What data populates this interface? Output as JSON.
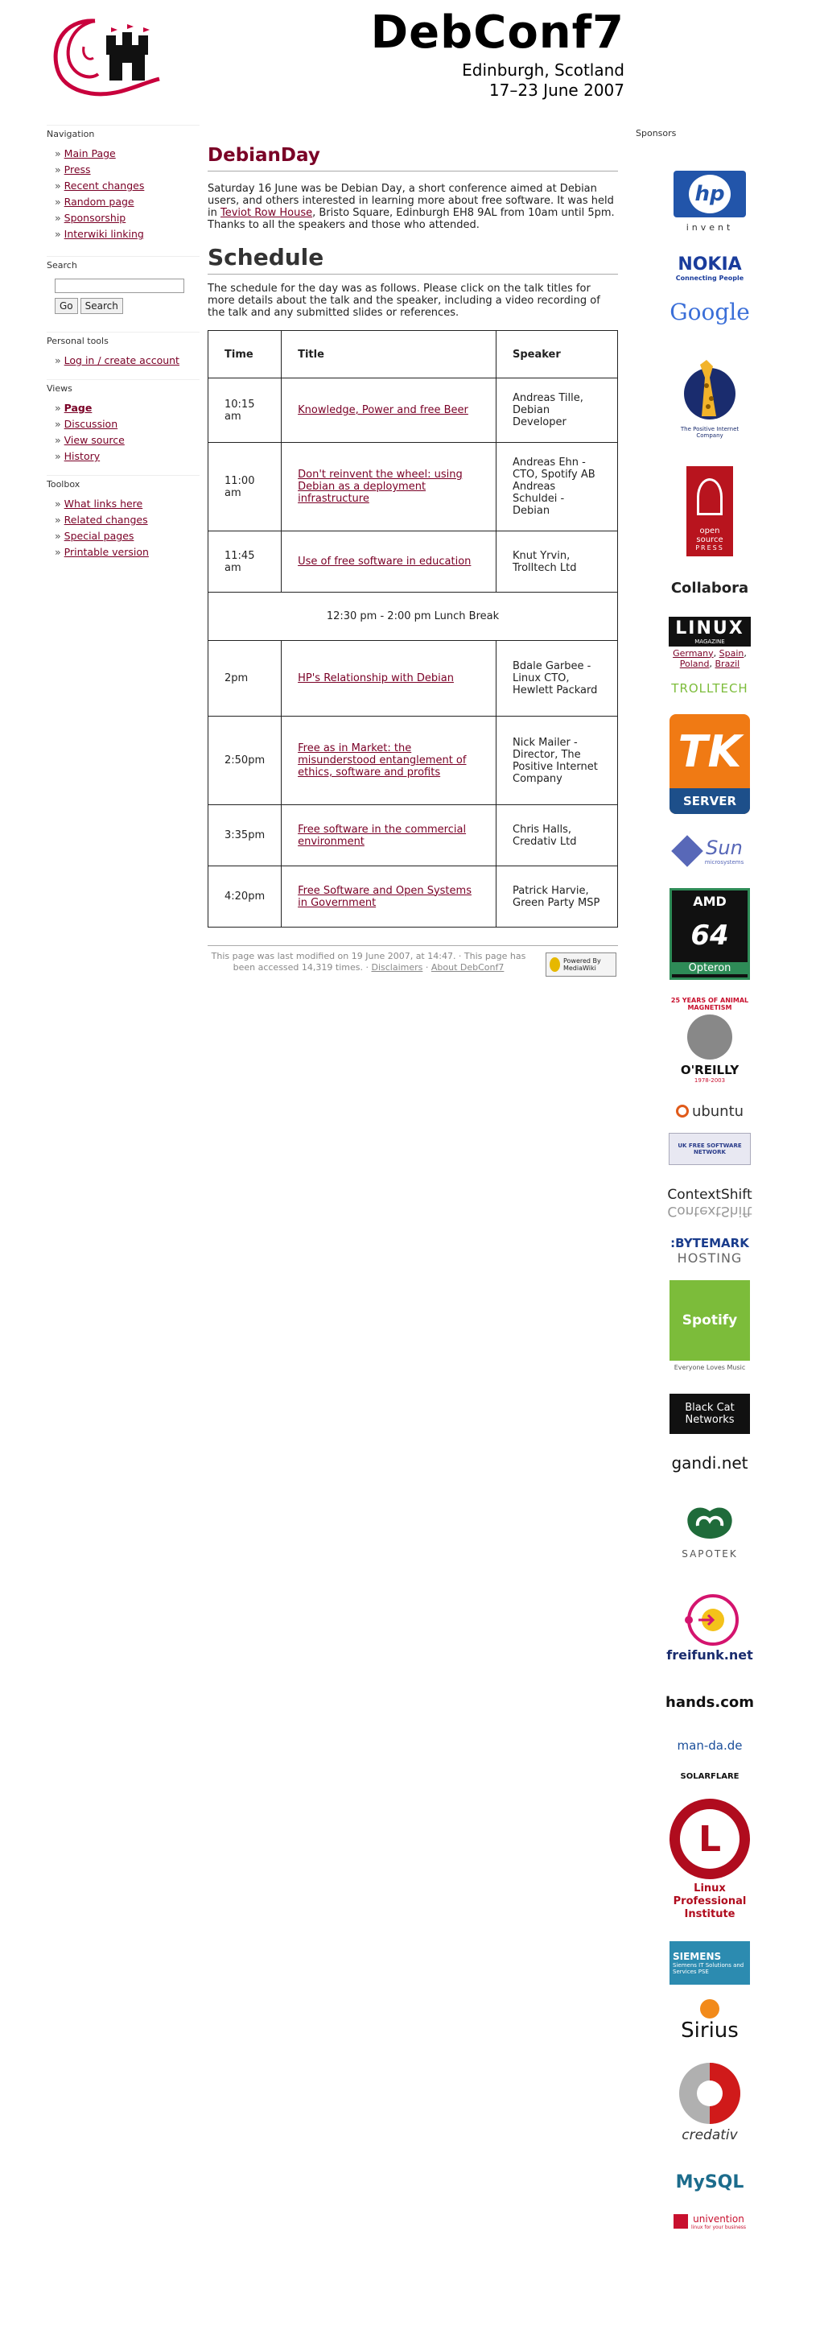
{
  "header": {
    "title": "DebConf7",
    "location": "Edinburgh, Scotland",
    "dates": "17–23 June 2007"
  },
  "sidebar": {
    "navigation": {
      "title": "Navigation",
      "items": [
        "Main Page",
        "Press",
        "Recent changes",
        "Random page",
        "Sponsorship",
        "Interwiki linking"
      ]
    },
    "search": {
      "title": "Search",
      "input_value": "",
      "go_label": "Go",
      "search_label": "Search"
    },
    "personal": {
      "title": "Personal tools",
      "items": [
        "Log in / create account"
      ]
    },
    "views": {
      "title": "Views",
      "items": [
        "Page",
        "Discussion",
        "View source",
        "History"
      ]
    },
    "toolbox": {
      "title": "Toolbox",
      "items": [
        "What links here",
        "Related changes",
        "Special pages",
        "Printable version"
      ]
    }
  },
  "content": {
    "page_title": "DebianDay",
    "intro_pre": "Saturday 16 June was be Debian Day, a short conference aimed at Debian users, and others interested in learning more about free software. It was held in ",
    "intro_link": "Teviot Row House",
    "intro_post": ", Bristo Square, Edinburgh EH8 9AL from 10am until 5pm. Thanks to all the speakers and those who attended.",
    "schedule_heading": "Schedule",
    "schedule_intro": "The schedule for the day was as follows. Please click on the talk titles for more details about the talk and the speaker, including a video recording of the talk and any submitted slides or references.",
    "table": {
      "headers": [
        "Time",
        "Title",
        "Speaker"
      ],
      "rows": [
        {
          "time": "10:15 am",
          "title": "Knowledge, Power and free Beer",
          "speaker": "Andreas Tille, Debian Developer"
        },
        {
          "time": "11:00 am",
          "title": "Don't reinvent the wheel: using Debian as a deployment infrastructure",
          "speaker": "Andreas Ehn - CTO, Spotify AB\nAndreas Schuldei - Debian"
        },
        {
          "time": "11:45 am",
          "title": "Use of free software in education",
          "speaker": "Knut Yrvin, Trolltech Ltd"
        },
        {
          "lunch": "12:30 pm - 2:00 pm Lunch Break"
        },
        {
          "time": "2pm",
          "title": "HP's Relationship with Debian",
          "speaker": "Bdale Garbee - Linux CTO, Hewlett Packard"
        },
        {
          "time": "2:50pm",
          "title": "Free as in Market: the misunderstood entanglement of ethics, software and profits",
          "speaker": "Nick Mailer - Director, The Positive Internet Company"
        },
        {
          "time": "3:35pm",
          "title": "Free software in the commercial environment",
          "speaker": "Chris Halls, Credativ Ltd"
        },
        {
          "time": "4:20pm",
          "title": "Free Software and Open Systems in Government",
          "speaker": "Patrick Harvie, Green Party MSP"
        }
      ]
    },
    "footer": {
      "text_pre": "This page was last modified on 19 June 2007, at 14:47. · This page has been accessed 14,319 times. · ",
      "disclaimers": "Disclaimers",
      "sep": " · ",
      "about": "About DebConf7",
      "badge": "Powered By MediaWiki"
    }
  },
  "sponsors": {
    "title": "Sponsors",
    "hp_caption": "invent",
    "nokia": "NOKIA",
    "nokia_sub": "Connecting People",
    "google": "Google",
    "positive": "The Positive Internet Company",
    "opensource": "open source",
    "press": "PRESS",
    "collabora": "Collabora",
    "linux": "LINUX",
    "linux_sub": "MAGAZINE",
    "linux_links": [
      "Germany",
      "Spain",
      "Poland",
      "Brazil"
    ],
    "trolltech": "TROLLTECH",
    "tk": "TK",
    "tk_sub": "SERVER",
    "sun": "Sun",
    "sun_sub": "microsystems",
    "amd": "AMD",
    "amd_64": "64",
    "amd_sub": "Opteron",
    "oreilly_top": "25 YEARS OF ANIMAL MAGNETISM",
    "oreilly": "O'REILLY",
    "oreilly_sub": "1978-2003",
    "ubuntu": "ubuntu",
    "ukfree": "UK FREE SOFTWARE NETWORK",
    "contextshift": "ContextShift",
    "bytemark": ":BYTEMARK",
    "bytemark_sub": "HOSTING",
    "spotify": "Spotify",
    "spotify_sub": "Everyone Loves Music",
    "blackcat": "Black Cat Networks",
    "gandi": "gandi.net",
    "sapotek": "SAPOTEK",
    "freifunk": "freifunk.net",
    "hands": "hands.com",
    "manda": "man-da.de",
    "solarflare": "SOLARFLARE",
    "lpi": [
      "Linux",
      "Professional",
      "Institute"
    ],
    "siemens": "SIEMENS",
    "siemens_sub": "Siemens IT Solutions and Services PSE",
    "sirius": "Sirius",
    "credativ": "credativ",
    "mysql": "MySQL",
    "univention": "univention",
    "univention_sub": "linux for your business"
  },
  "colors": {
    "accent": "#7a0026",
    "text": "#222222",
    "border": "#aaaaaa"
  }
}
